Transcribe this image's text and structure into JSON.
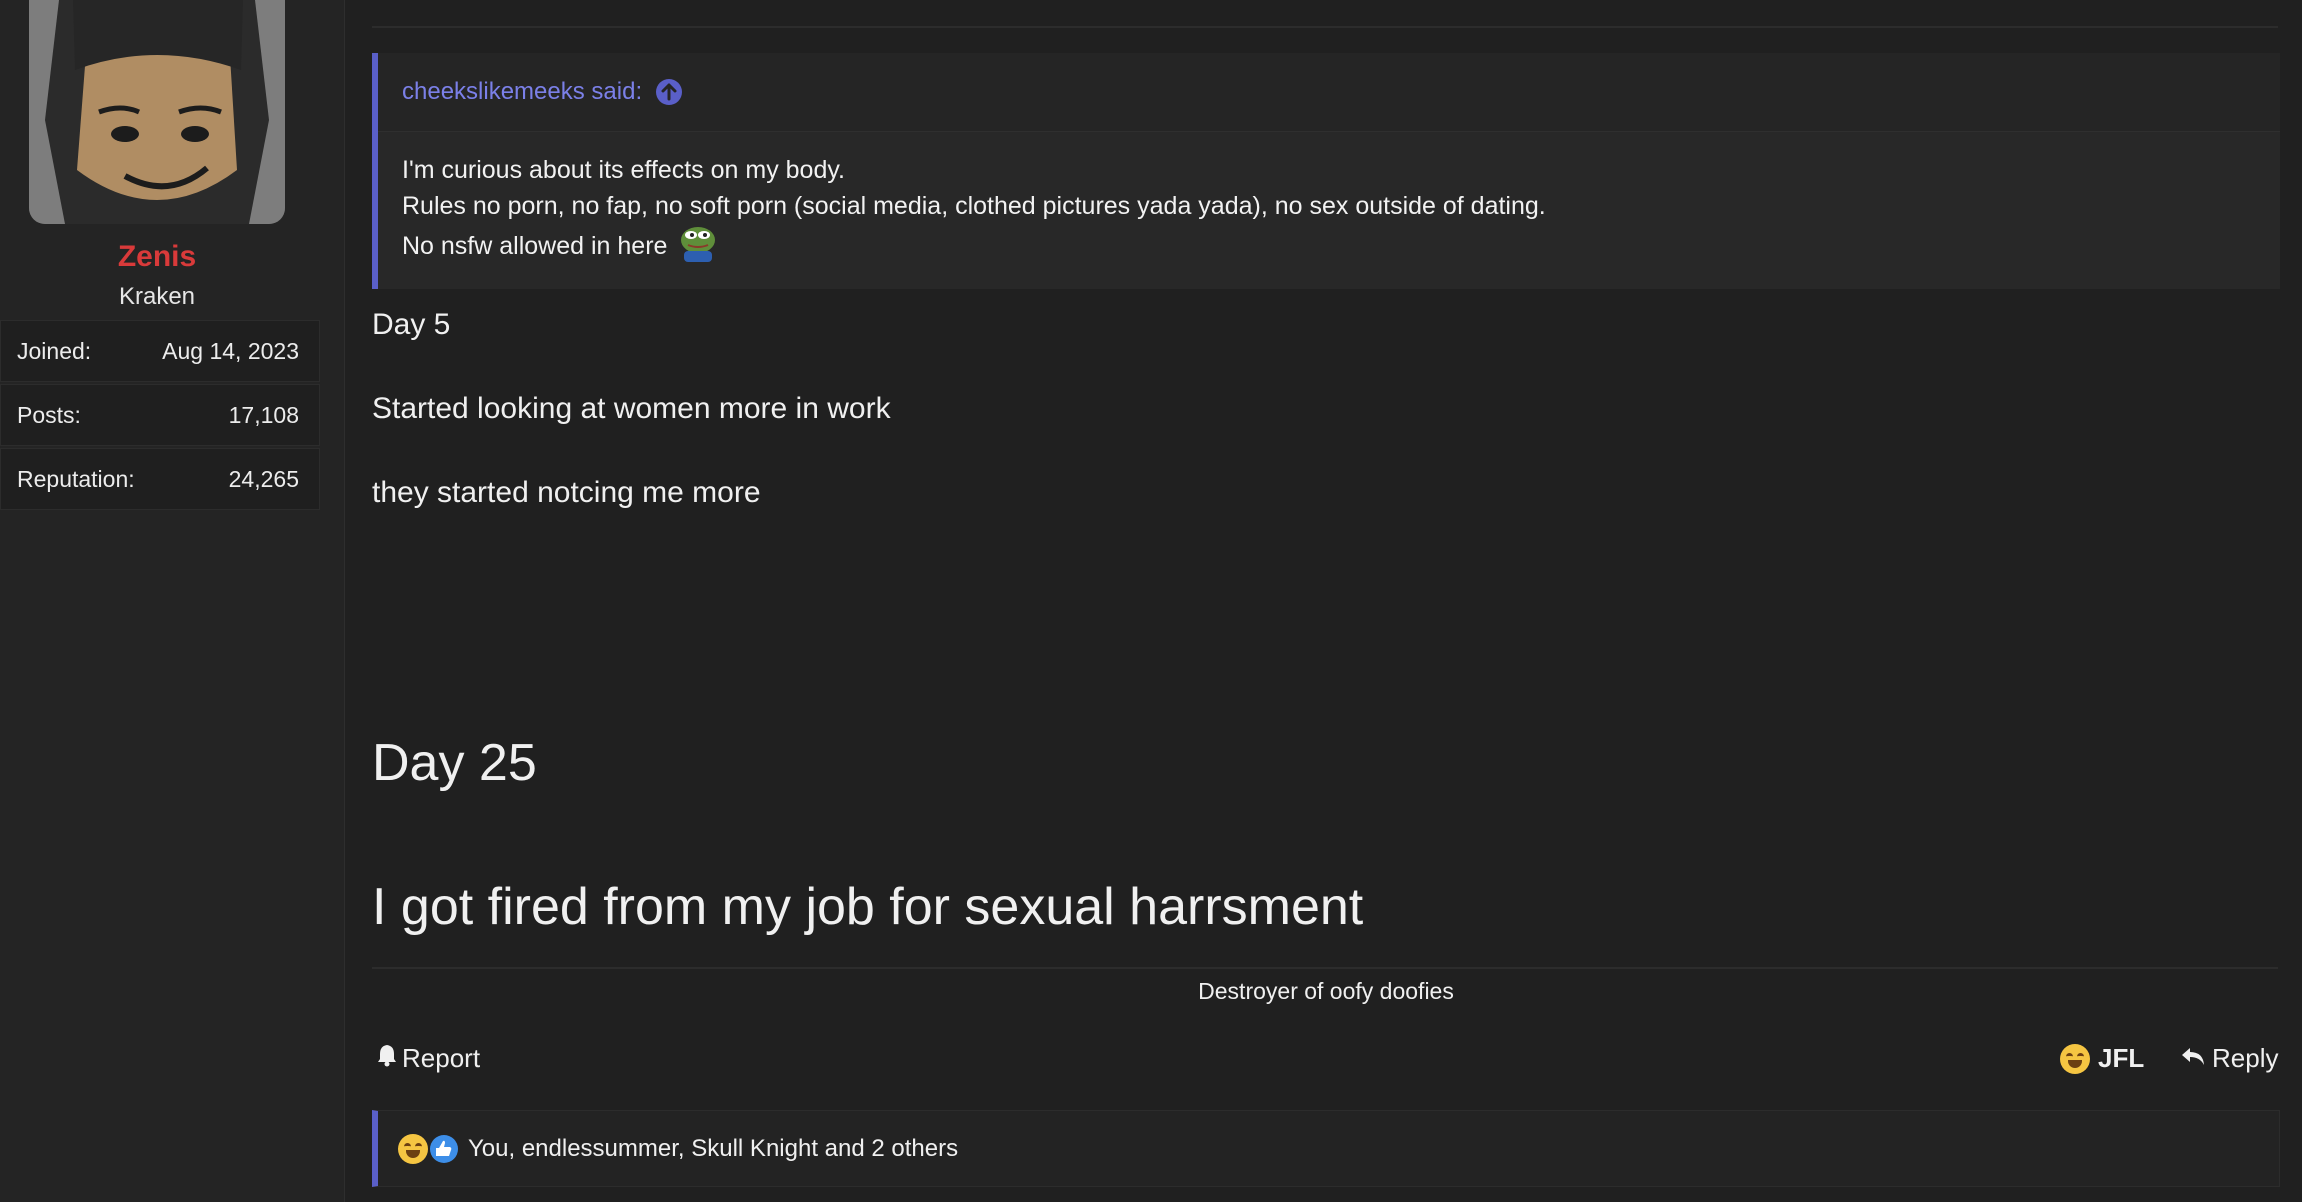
{
  "user": {
    "name": "Zenis",
    "title": "Kraken",
    "stats": [
      {
        "label": "Joined:",
        "value": "Aug 14, 2023"
      },
      {
        "label": "Posts:",
        "value": "17,108"
      },
      {
        "label": "Reputation:",
        "value": "24,265"
      }
    ]
  },
  "quote": {
    "author_line": "cheekslikemeeks said:",
    "lines": [
      "I'm curious about its effects on my body.",
      "Rules no porn, no fap, no soft porn (social media, clothed pictures yada yada), no sex outside of dating.",
      "No nsfw allowed in here"
    ]
  },
  "message": {
    "line1": "Day 5",
    "line2": "Started looking at women more in work",
    "line3": "they started notcing me more",
    "line4": "Day 25",
    "line5": "I got fired from my job for sexual harrsment"
  },
  "signature": "Destroyer of oofy doofies",
  "actions": {
    "report": "Report",
    "jfl": "JFL",
    "reply": "Reply"
  },
  "reactions": {
    "text": "You, endlessummer, Skull Knight and 2 others"
  },
  "colors": {
    "background": "#202020",
    "username": "#d93a3a",
    "quote_accent": "#5a5fc8",
    "quote_author": "#7b80e8"
  }
}
